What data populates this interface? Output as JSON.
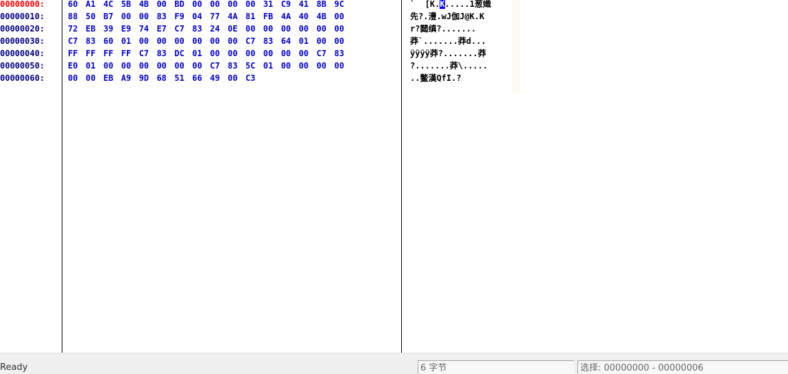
{
  "offsets": [
    "00000000:",
    "00000010:",
    "00000020:",
    "00000030:",
    "00000040:",
    "00000050:",
    "00000060:"
  ],
  "hex_rows": [
    [
      "60",
      "A1",
      "4C",
      "5B",
      "4B",
      "00",
      "BD",
      "00",
      "00",
      "00",
      "00",
      "31",
      "C9",
      "41",
      "8B",
      "9C"
    ],
    [
      "88",
      "50",
      "B7",
      "00",
      "00",
      "83",
      "F9",
      "04",
      "77",
      "4A",
      "81",
      "FB",
      "4A",
      "40",
      "4B",
      "00"
    ],
    [
      "72",
      "EB",
      "39",
      "E9",
      "74",
      "E7",
      "C7",
      "83",
      "24",
      "0E",
      "00",
      "00",
      "00",
      "00",
      "00",
      "00"
    ],
    [
      "C7",
      "83",
      "60",
      "01",
      "00",
      "00",
      "00",
      "00",
      "00",
      "00",
      "C7",
      "83",
      "64",
      "01",
      "00",
      "00"
    ],
    [
      "FF",
      "FF",
      "FF",
      "FF",
      "C7",
      "83",
      "DC",
      "01",
      "00",
      "00",
      "00",
      "00",
      "00",
      "00",
      "C7",
      "83"
    ],
    [
      "E0",
      "01",
      "00",
      "00",
      "00",
      "00",
      "00",
      "00",
      "C7",
      "83",
      "5C",
      "01",
      "00",
      "00",
      "00",
      "00"
    ],
    [
      "00",
      "00",
      "EB",
      "A9",
      "9D",
      "68",
      "51",
      "66",
      "49",
      "00",
      "C3"
    ]
  ],
  "ascii_rows": [
    {
      "pre": "`  [K.",
      "cursor": "K",
      "post": ".....1葱嬂"
    },
    {
      "pre": "先?.澧.wJ伽J@K.K",
      "cursor": "",
      "post": ""
    },
    {
      "pre": "r?閮缜?.......",
      "cursor": "",
      "post": ""
    },
    {
      "pre": "莽`.......莽d...",
      "cursor": "",
      "post": ""
    },
    {
      "pre": "ÿÿÿÿ莽?.......莽",
      "cursor": "",
      "post": ""
    },
    {
      "pre": "?.......莽\\.....",
      "cursor": "",
      "post": ""
    },
    {
      "pre": "..鳖漢QfI.?",
      "cursor": "",
      "post": ""
    }
  ],
  "status": {
    "ready": "Ready",
    "size": "6 字节",
    "selection": "选择: 00000000 - 00000006"
  },
  "colors": {
    "offset_active": "#ff0000",
    "offset": "#000080",
    "hex": "#0000cc",
    "cursor_bg": "#0000ff"
  }
}
